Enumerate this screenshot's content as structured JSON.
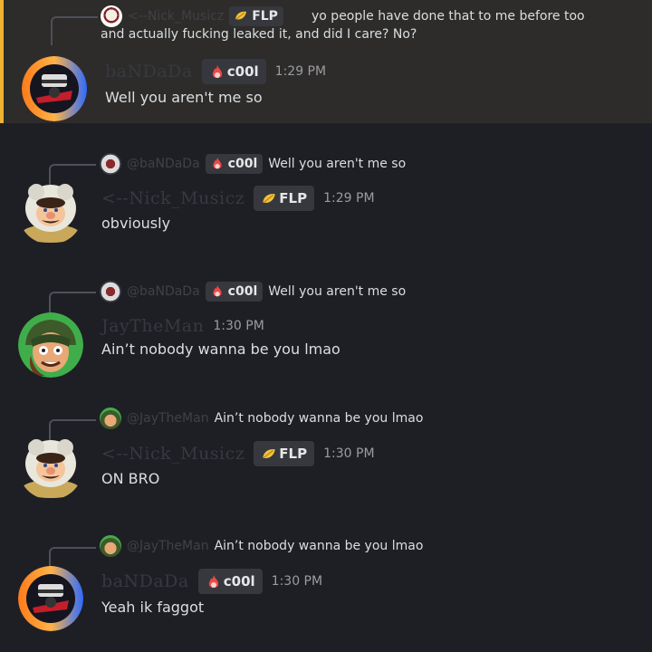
{
  "messages": [
    {
      "reply": {
        "name": "<--Nick_Musicz",
        "tag": "FLP",
        "text": "yo people have done that to me before too and actually fucking leaked it, and did I care? No?"
      },
      "author": "baNDaDa",
      "tag": "c00l",
      "time": "1:29 PM",
      "content": "Well you aren't me so"
    },
    {
      "reply": {
        "name": "@baNDaDa",
        "tag": "c00l",
        "text": "Well you aren't me so"
      },
      "author": "<--Nick_Musicz",
      "tag": "FLP",
      "time": "1:29 PM",
      "content": "obviously"
    },
    {
      "reply": {
        "name": "@baNDaDa",
        "tag": "c00l",
        "text": "Well you aren't me so"
      },
      "author": "JayTheMan",
      "time": "1:30 PM",
      "content": "Ain’t nobody wanna be you lmao"
    },
    {
      "reply": {
        "name": "@JayTheMan",
        "text": "Ain’t nobody wanna be you lmao"
      },
      "author": "<--Nick_Musicz",
      "tag": "FLP",
      "time": "1:30 PM",
      "content": "ON BRO"
    },
    {
      "reply": {
        "name": "@JayTheMan",
        "text": "Ain’t nobody wanna be you lmao"
      },
      "author": "baNDaDa",
      "tag": "c00l",
      "time": "1:30 PM",
      "content": "Yeah ik faggot"
    }
  ],
  "colors": {
    "background": "#1e1f24",
    "highlight": "#2d2c2b",
    "highlight_bar": "#f0b232",
    "tag_bg": "#37383e"
  },
  "icons": [
    "fire-tag-icon",
    "gold-leaf-tag-icon",
    "avatar-bandada",
    "avatar-nick",
    "avatar-jay"
  ]
}
